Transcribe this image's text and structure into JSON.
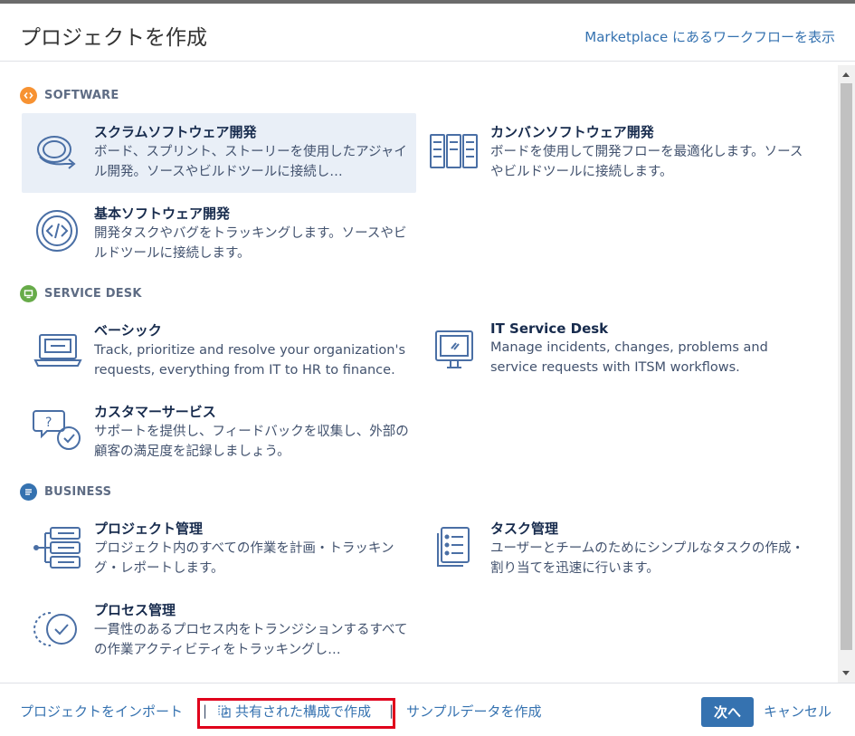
{
  "dialog": {
    "title": "プロジェクトを作成",
    "marketplace_link": "Marketplace にあるワークフローを表示"
  },
  "sections": [
    {
      "name": "SOFTWARE",
      "icon": "code-icon",
      "color": "#f79232",
      "templates": [
        {
          "name": "スクラムソフトウェア開発",
          "description": "ボード、スプリント、ストーリーを使用したアジャイル開発。ソースやビルドツールに接続し…",
          "icon": "scrum-cycle-icon",
          "selected": true
        },
        {
          "name": "カンバンソフトウェア開発",
          "description": "ボードを使用して開発フローを最適化します。ソースやビルドツールに接続します。",
          "icon": "kanban-board-icon"
        },
        {
          "name": "基本ソフトウェア開発",
          "description": "開発タスクやバグをトラッキングします。ソースやビルドツールに接続します。",
          "icon": "code-brackets-icon"
        }
      ]
    },
    {
      "name": "SERVICE DESK",
      "icon": "monitor-icon",
      "color": "#67ab49",
      "templates": [
        {
          "name": "ベーシック",
          "description": "Track, prioritize and resolve your organization's requests, everything from IT to HR to finance.",
          "icon": "laptop-icon"
        },
        {
          "name": "IT Service Desk",
          "description": "Manage incidents, changes, problems and service requests with ITSM workflows.",
          "icon": "monitor-icon"
        },
        {
          "name": "カスタマーサービス",
          "description": "サポートを提供し、フィードバックを収集し、外部の顧客の満足度を記録しましょう。",
          "icon": "chat-bubbles-icon"
        }
      ]
    },
    {
      "name": "BUSINESS",
      "icon": "document-icon",
      "color": "#3572b0",
      "templates": [
        {
          "name": "プロジェクト管理",
          "description": "プロジェクト内のすべての作業を計画・トラッキング・レポートします。",
          "icon": "project-list-icon"
        },
        {
          "name": "タスク管理",
          "description": "ユーザーとチームのためにシンプルなタスクの作成・割り当てを迅速に行います。",
          "icon": "task-list-icon"
        },
        {
          "name": "プロセス管理",
          "description": "一貫性のあるプロセス内をトランジションするすべての作業アクティビティをトラッキングし…",
          "icon": "process-check-icon"
        }
      ]
    }
  ],
  "footer": {
    "import_link": "プロジェクトをインポート",
    "separator": "|",
    "shared_config_link": "共有された構成で作成",
    "sample_data_link": "サンプルデータを作成",
    "next_button": "次へ",
    "cancel_button": "キャンセル"
  }
}
